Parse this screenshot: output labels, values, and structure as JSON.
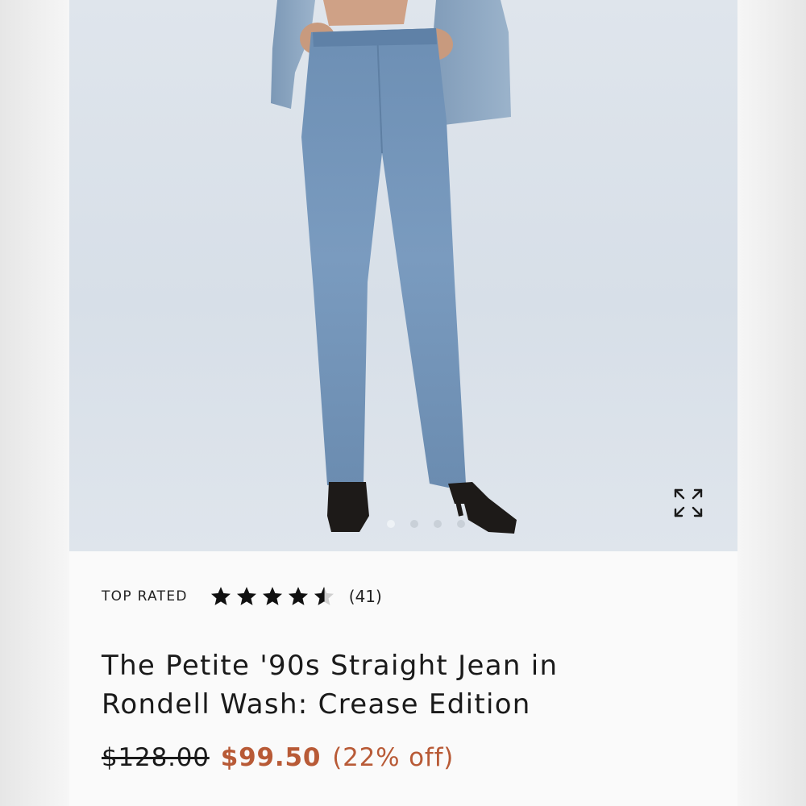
{
  "product": {
    "badge": "TOP RATED",
    "rating": {
      "value": 4.5,
      "max": 5,
      "review_count": "(41)"
    },
    "title": "The Petite '90s Straight Jean in Rondell Wash: Crease Edition",
    "price": {
      "original": "$128.00",
      "sale": "$99.50",
      "discount": "(22% off)"
    }
  },
  "gallery": {
    "slide_count": 4,
    "active_slide": 1,
    "expand_icon": "expand-arrows-icon"
  },
  "colors": {
    "sale": "#b85a36",
    "text": "#1a1a1a",
    "denim": "#6b8fb5"
  }
}
